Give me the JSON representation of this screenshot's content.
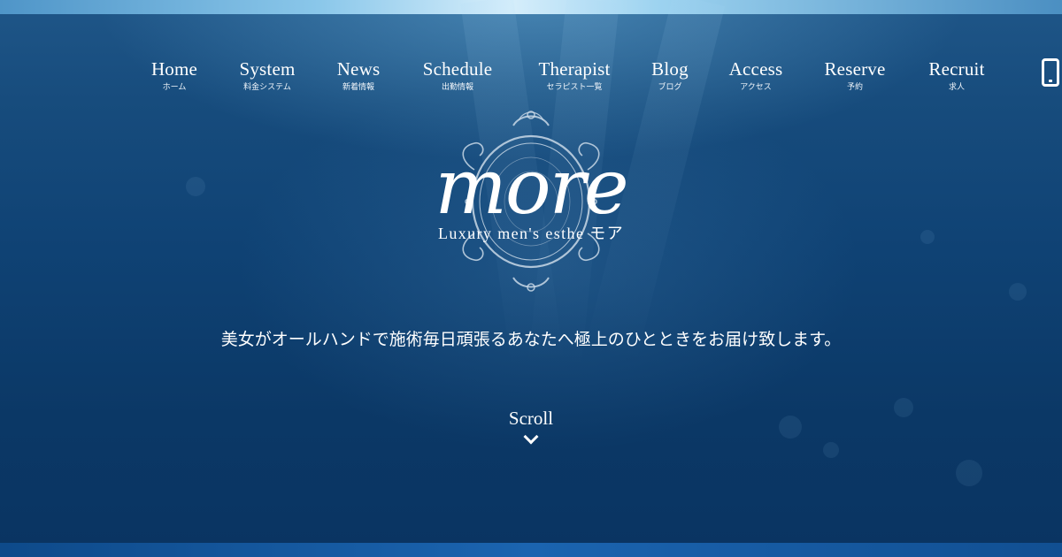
{
  "nav": {
    "items": [
      {
        "en": "Home",
        "ja": "ホーム"
      },
      {
        "en": "System",
        "ja": "料金システム"
      },
      {
        "en": "News",
        "ja": "新着情報"
      },
      {
        "en": "Schedule",
        "ja": "出勤情報"
      },
      {
        "en": "Therapist",
        "ja": "セラピスト一覧"
      },
      {
        "en": "Blog",
        "ja": "ブログ"
      },
      {
        "en": "Access",
        "ja": "アクセス"
      },
      {
        "en": "Reserve",
        "ja": "予約"
      },
      {
        "en": "Recruit",
        "ja": "求人"
      }
    ],
    "phone_icon": "smartphone-icon"
  },
  "logo": {
    "word": "more",
    "subtitle": "Luxury men's esthe モア"
  },
  "hero": {
    "tagline": "美女がオールハンドで施術毎日頑張るあなたへ極上のひとときをお届け致します。"
  },
  "scroll": {
    "label": "Scroll",
    "icon": "chevron-down-icon"
  },
  "colors": {
    "deep_sea": "#0b3866",
    "surface": "#d6eefb",
    "text": "#ffffff"
  }
}
